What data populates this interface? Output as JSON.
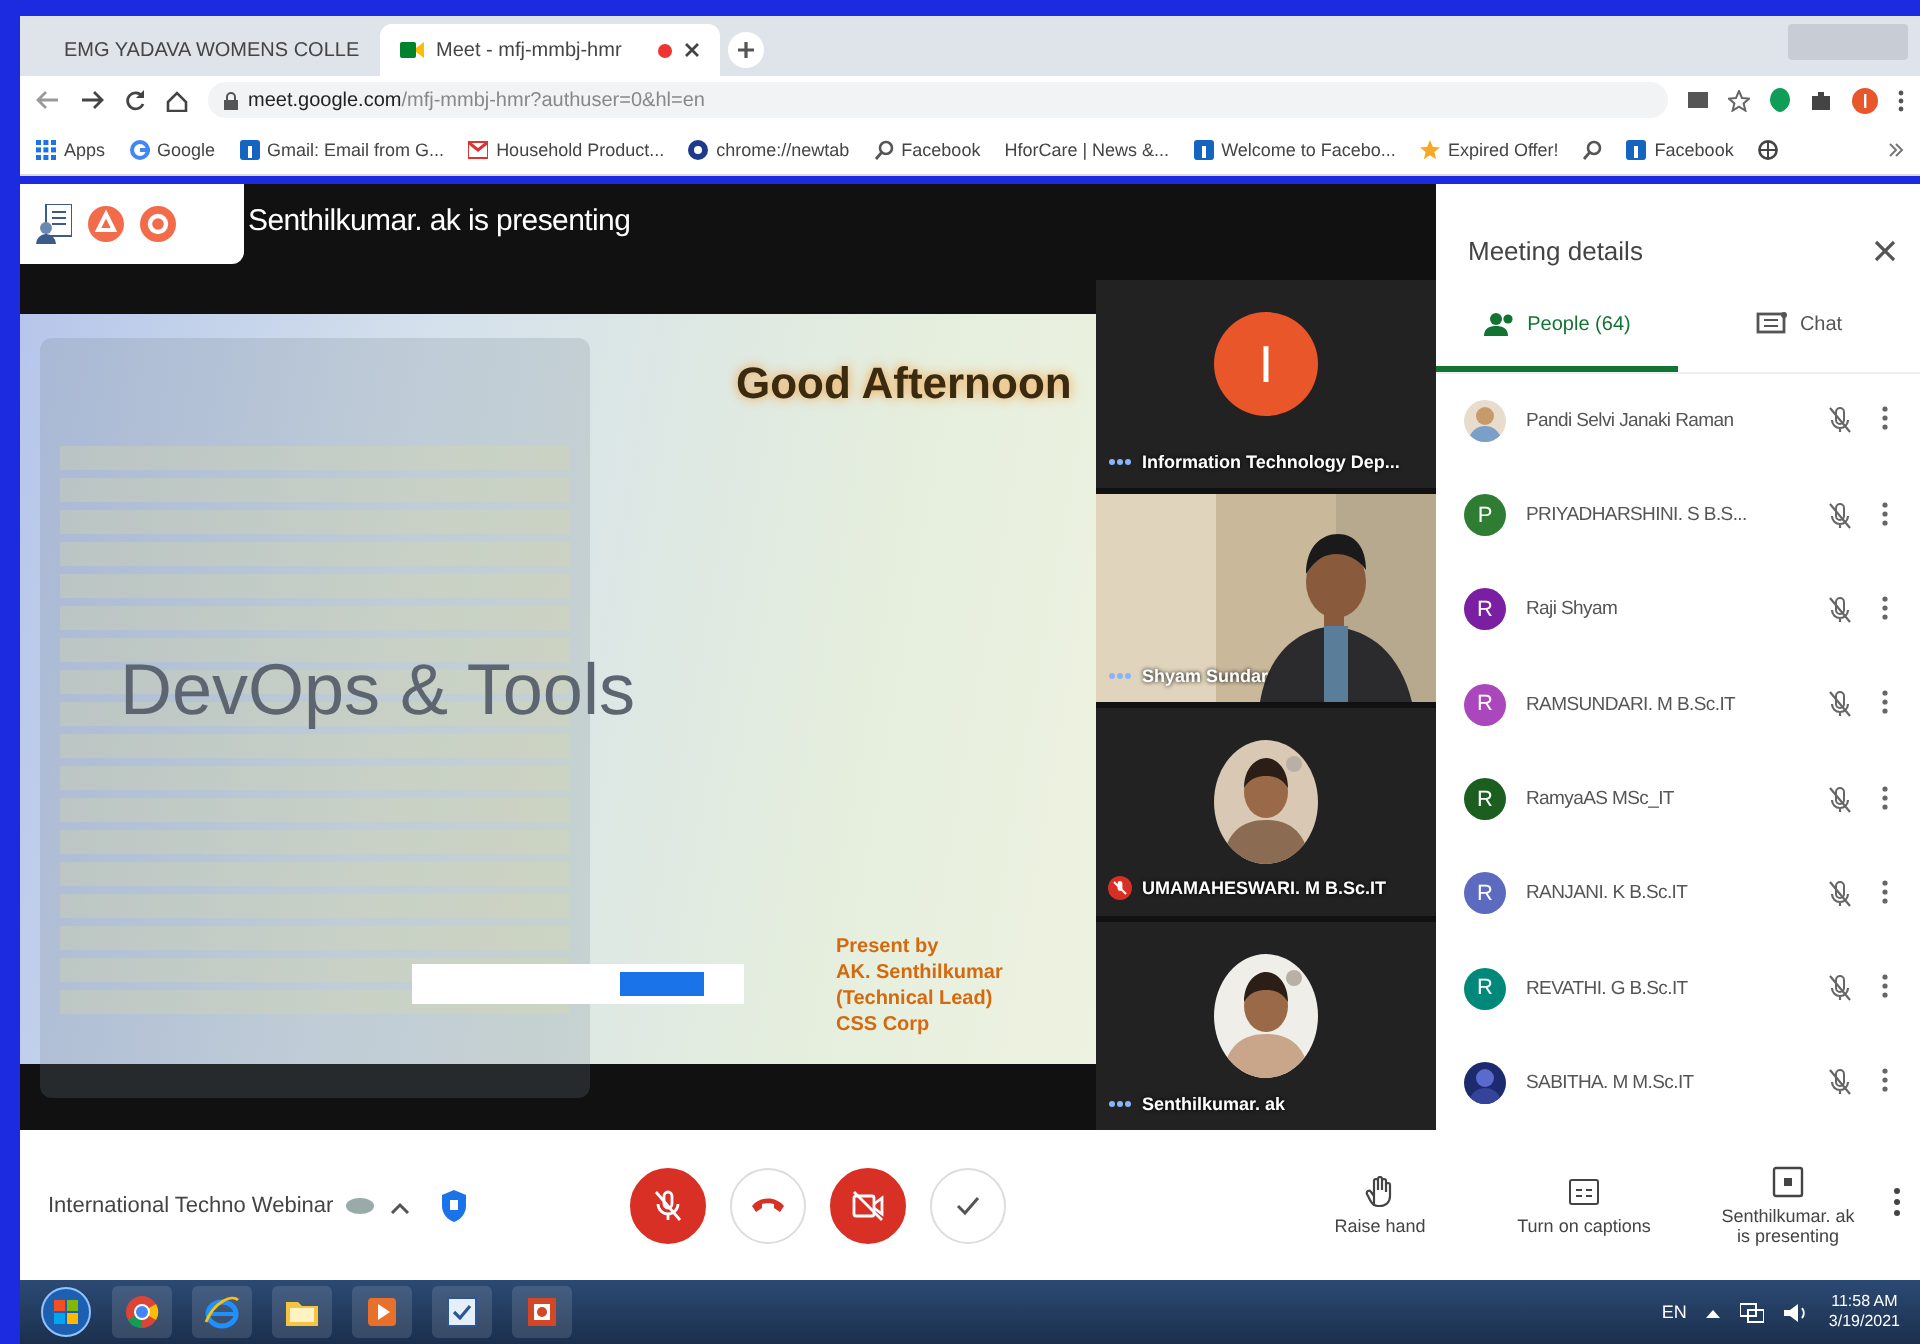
{
  "browser": {
    "tabs": [
      {
        "title": "EMG YADAVA WOMENS COLLE",
        "selected": false
      },
      {
        "title": "Meet - mfj-mmbj-hmr",
        "selected": true
      }
    ],
    "url_host": "meet.google.com",
    "url_path": "/mfj-mmbj-hmr?authuser=0&hl=en",
    "bookmarks": [
      {
        "label": "Apps",
        "kind": "apps"
      },
      {
        "label": "Google",
        "kind": "google"
      },
      {
        "label": "Gmail: Email from G...",
        "kind": "blue"
      },
      {
        "label": "Household Product...",
        "kind": "gmail"
      },
      {
        "label": "chrome://newtab",
        "kind": "dark"
      },
      {
        "label": "Facebook",
        "kind": "search"
      },
      {
        "label": "HforCare | News &...",
        "kind": "none"
      },
      {
        "label": "Welcome to Facebo...",
        "kind": "blue"
      },
      {
        "label": "Expired Offer!",
        "kind": "star"
      },
      {
        "kind": "search"
      },
      {
        "label": "Facebook",
        "kind": "blue"
      },
      {
        "kind": "globe"
      }
    ]
  },
  "meeting": {
    "presenter_banner": "Senthilkumar. ak is presenting",
    "slide": {
      "title": "Good Afternoon",
      "heading": "DevOps & Tools",
      "credits": [
        "Present by",
        "AK. Senthilkumar",
        "(Technical Lead)",
        "CSS Corp"
      ]
    },
    "tiles": [
      {
        "name": "Information Technology Dep...",
        "kind": "avatar",
        "letter": "I",
        "color": "#e8562a",
        "muted": false
      },
      {
        "name": "Shyam Sundar",
        "kind": "video",
        "muted": false
      },
      {
        "name": "UMAMAHESWARI. M B.Sc.IT",
        "muted": true
      },
      {
        "name": "Senthilkumar. ak",
        "muted": false
      }
    ],
    "panel": {
      "title": "Meeting details",
      "tabs": [
        {
          "label": "People (64)",
          "selected": true
        },
        {
          "label": "Chat",
          "selected": false
        }
      ],
      "people": [
        {
          "name": "Pandi Selvi Janaki Raman"
        },
        {
          "name": "PRIYADHARSHINI. S B.S...",
          "kind": "letter",
          "letter": "P",
          "color": "#2e7d32"
        },
        {
          "name": "Raji Shyam",
          "kind": "letter",
          "letter": "R",
          "color": "#7b1fa2"
        },
        {
          "name": "RAMSUNDARI. M B.Sc.IT",
          "kind": "letter",
          "letter": "R",
          "color": "#ab47bc"
        },
        {
          "name": "RamyaAS MSc_IT",
          "kind": "letter",
          "letter": "R",
          "color": "#1b5e20"
        },
        {
          "name": "RANJANI. K B.Sc.IT",
          "kind": "letter",
          "letter": "R",
          "color": "#5c6bc0"
        },
        {
          "name": "REVATHI. G B.Sc.IT",
          "kind": "letter",
          "letter": "R",
          "color": "#00897b"
        },
        {
          "name": "SABITHA. M M.Sc.IT"
        }
      ]
    },
    "bottom": {
      "meeting_name": "International Techno Webinar",
      "actions": [
        {
          "label": "Raise hand",
          "kind": "hand"
        },
        {
          "label": "Turn on captions",
          "kind": "cc"
        },
        {
          "label": "Senthilkumar. ak is presenting",
          "kind": "present"
        }
      ]
    }
  },
  "taskbar": {
    "language": "EN",
    "time": "11:58 AM",
    "date": "3/19/2021"
  }
}
